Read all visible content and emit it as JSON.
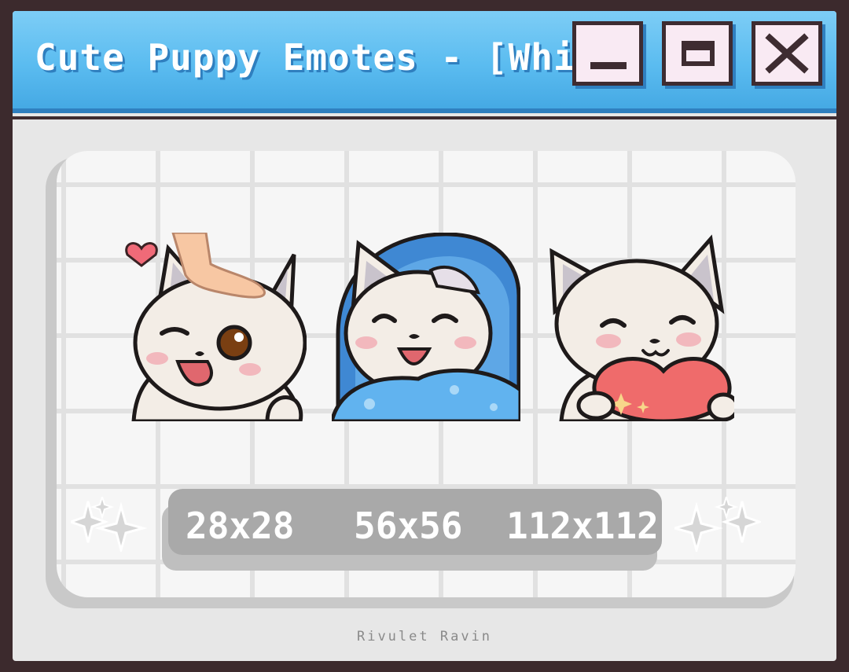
{
  "window": {
    "title": "Cute Puppy Emotes - [White]",
    "buttons": {
      "minimize": "minimize-icon",
      "maximize": "maximize-icon",
      "close": "close-icon"
    }
  },
  "emotes": [
    {
      "name": "puppy-headpat-emote"
    },
    {
      "name": "puppy-blanket-emote"
    },
    {
      "name": "puppy-heart-emote"
    }
  ],
  "sizes": [
    "28x28",
    "56x56",
    "112x112"
  ],
  "decorations": {
    "left": "sparkle-icon",
    "right": "sparkle-icon"
  },
  "credit": "Rivulet Ravin",
  "colors": {
    "frame": "#3c2a2d",
    "titlebar": "#5bbcf0",
    "button_fill": "#f9eaf3",
    "panel": "#f6f6f6",
    "size_bar": "#a9a9a9"
  }
}
